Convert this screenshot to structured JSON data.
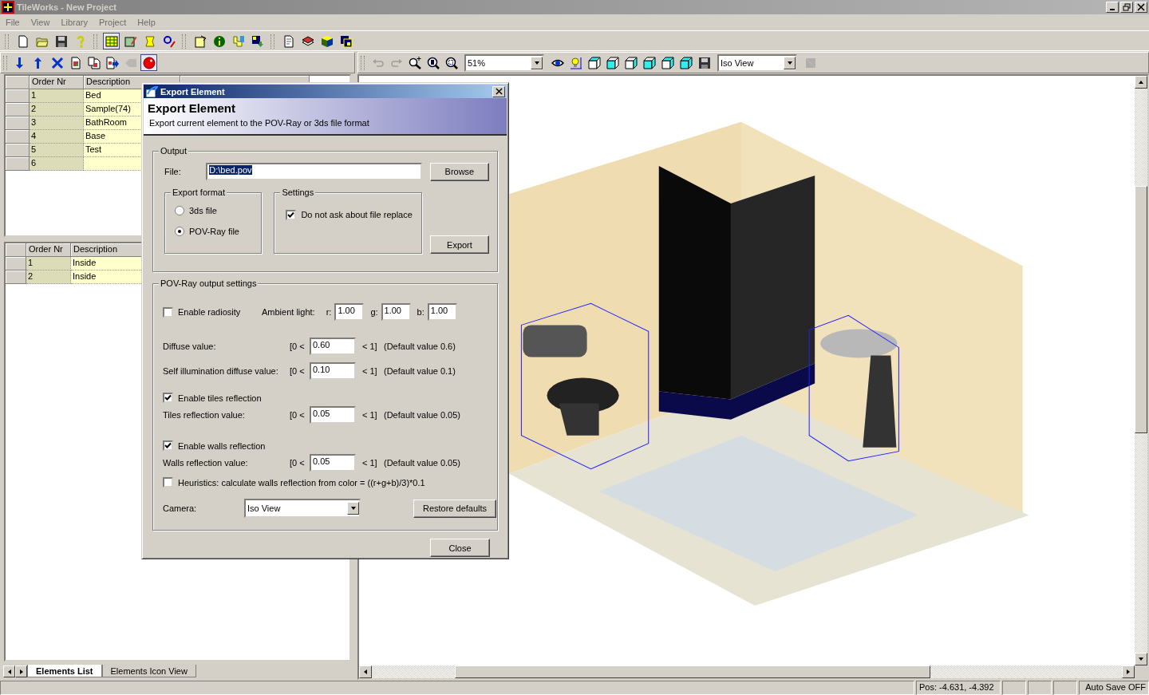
{
  "window": {
    "title": "TileWorks - New Project"
  },
  "menu": [
    "File",
    "View",
    "Library",
    "Project",
    "Help"
  ],
  "main_toolbar": [
    {
      "pressed": false,
      "disabled": false
    },
    {
      "pressed": false,
      "disabled": false
    },
    {
      "pressed": false,
      "disabled": false
    },
    {
      "pressed": false,
      "disabled": false
    },
    {
      "pressed": true,
      "disabled": false
    },
    {
      "pressed": false,
      "disabled": false
    },
    {
      "pressed": false,
      "disabled": false
    },
    {
      "pressed": false,
      "disabled": false
    },
    {
      "pressed": false,
      "disabled": false
    },
    {
      "pressed": false,
      "disabled": false
    },
    {
      "pressed": false,
      "disabled": false
    },
    {
      "pressed": false,
      "disabled": false
    },
    {
      "pressed": false,
      "disabled": false
    },
    {
      "pressed": false,
      "disabled": false
    },
    {
      "pressed": false,
      "disabled": false
    },
    {
      "pressed": false,
      "disabled": false
    }
  ],
  "element_toolbar": [
    {
      "pressed": false,
      "disabled": false
    },
    {
      "pressed": false,
      "disabled": false
    },
    {
      "pressed": false,
      "disabled": false
    },
    {
      "pressed": false,
      "disabled": false
    },
    {
      "pressed": false,
      "disabled": false
    },
    {
      "pressed": false,
      "disabled": false
    },
    {
      "pressed": false,
      "disabled": true
    },
    {
      "pressed": true,
      "disabled": false
    }
  ],
  "view_toolbar": {
    "left_buttons": [
      {
        "disabled": true
      },
      {
        "disabled": true
      },
      {
        "disabled": false
      },
      {
        "disabled": false
      },
      {
        "disabled": false
      }
    ],
    "zoom": "51%",
    "mid_buttons": [
      {
        "disabled": false
      },
      {
        "disabled": false
      },
      {
        "disabled": false
      },
      {
        "disabled": false
      },
      {
        "disabled": false
      },
      {
        "disabled": false
      },
      {
        "disabled": false
      },
      {
        "disabled": false
      },
      {
        "disabled": false
      }
    ],
    "camera": "Iso View",
    "right_buttons": [
      {
        "disabled": true
      }
    ]
  },
  "elements_table": {
    "columns": [
      "Order Nr",
      "Description"
    ],
    "rows": [
      {
        "order": "1",
        "description": "Bed"
      },
      {
        "order": "2",
        "description": "Sample(74)"
      },
      {
        "order": "3",
        "description": "BathRoom"
      },
      {
        "order": "4",
        "description": "Base"
      },
      {
        "order": "5",
        "description": "Test"
      },
      {
        "order": "6"
      }
    ]
  },
  "parts_table": {
    "columns": [
      "Order Nr",
      "Description"
    ],
    "rows": [
      {
        "order": "1",
        "description": "Inside"
      },
      {
        "order": "2",
        "description": "Inside"
      }
    ]
  },
  "tabs": [
    {
      "label": "Elements List",
      "selected": true
    },
    {
      "label": "Elements Icon View",
      "selected": false
    }
  ],
  "status_bar": {
    "position": "Pos: -4.631, -4.392",
    "autosave": "Auto Save OFF"
  },
  "dialog": {
    "title": "Export Element",
    "heading": "Export Element",
    "subtitle": "Export current element to the POV-Ray or 3ds file format",
    "output": {
      "legend": "Output",
      "file_label": "File:",
      "file_value": "D:\\bed.pov",
      "browse": "Browse",
      "format": {
        "legend": "Export format",
        "options": [
          {
            "label": "3ds file",
            "selected": false
          },
          {
            "label": "POV-Ray file",
            "selected": true
          }
        ]
      },
      "settings": {
        "legend": "Settings",
        "label": "Do not ask about file replace",
        "checked": true
      },
      "export": "Export"
    },
    "pov": {
      "legend": "POV-Ray output settings",
      "radiosity": {
        "label": "Enable radiosity",
        "checked": false
      },
      "ambient": {
        "label": "Ambient light:",
        "channels": [
          {
            "label": "r:",
            "value": "1.00"
          },
          {
            "label": "g:",
            "value": "1.00"
          },
          {
            "label": "b:",
            "value": "1.00"
          }
        ]
      },
      "rows": [
        {
          "kind": "value",
          "label": "Diffuse value:",
          "lower": "[0 <",
          "value": "0.60",
          "upper": "< 1]",
          "default": "(Default value 0.6)"
        },
        {
          "kind": "value",
          "label": "Self illumination diffuse value:",
          "lower": "[0 <",
          "value": "0.10",
          "upper": "< 1]",
          "default": "(Default value 0.1)"
        },
        {
          "kind": "check",
          "label": "Enable tiles reflection",
          "checked": true
        },
        {
          "kind": "value",
          "label": "Tiles reflection value:",
          "lower": "[0 <",
          "value": "0.05",
          "upper": "< 1]",
          "default": "(Default value 0.05)"
        },
        {
          "kind": "check",
          "label": "Enable walls reflection",
          "checked": true
        },
        {
          "kind": "value",
          "label": "Walls reflection value:",
          "lower": "[0 <",
          "value": "0.05",
          "upper": "< 1]",
          "default": "(Default value 0.05)"
        },
        {
          "kind": "check",
          "label": "Heuristics: calculate walls reflection from color = ((r+g+b)/3)*0.1",
          "checked": false
        }
      ],
      "camera": {
        "label": "Camera:",
        "value": "Iso View"
      },
      "restore": "Restore defaults"
    },
    "close": "Close"
  }
}
